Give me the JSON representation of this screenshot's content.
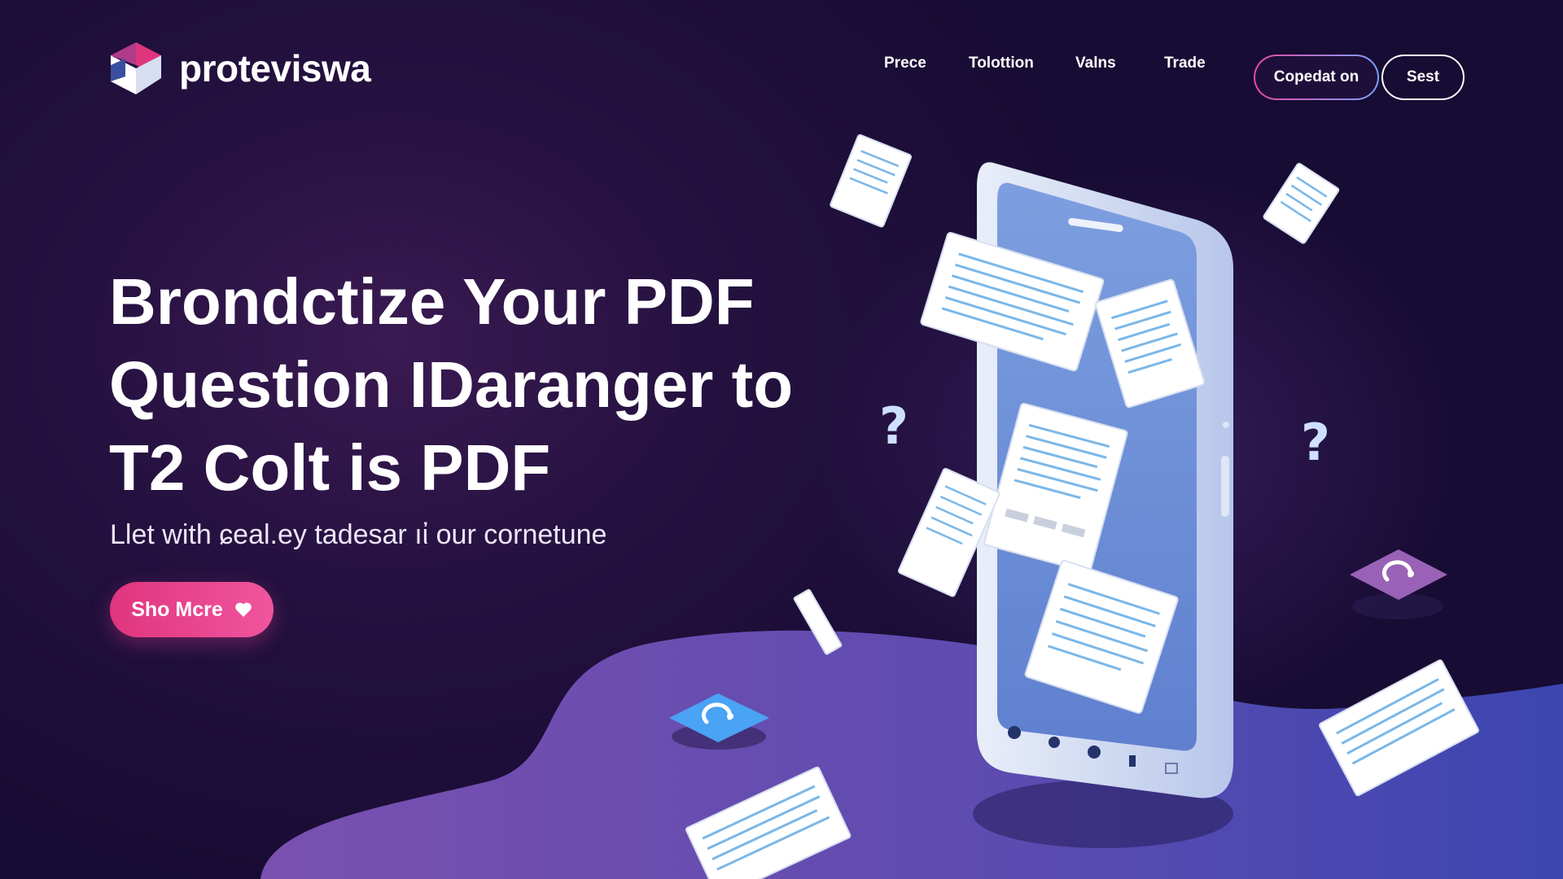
{
  "brand": {
    "name": "proteviswa"
  },
  "nav": {
    "items": [
      "Prece",
      "Tolottion",
      "Valns",
      "Trade"
    ]
  },
  "header": {
    "primary_button": "Copedat on",
    "secondary_button": "Sest"
  },
  "hero": {
    "headline_lines": [
      "Brondctize Your PDF",
      "Question ΙDaranger to",
      "T2 Colt is PDF"
    ],
    "subline": "Llet with ɕeal.ey tadesar ıἰ our cornetune",
    "cta_label": "Sho Mcre"
  },
  "colors": {
    "accent_pink": "#e0357f",
    "background": "#1e0f3a",
    "phone_screen": "#6f92d6",
    "blob": "#6a4aa8"
  },
  "icons": [
    "logo-cube-icon",
    "heart-icon",
    "question-mark-icon",
    "refresh-tile-icon"
  ]
}
